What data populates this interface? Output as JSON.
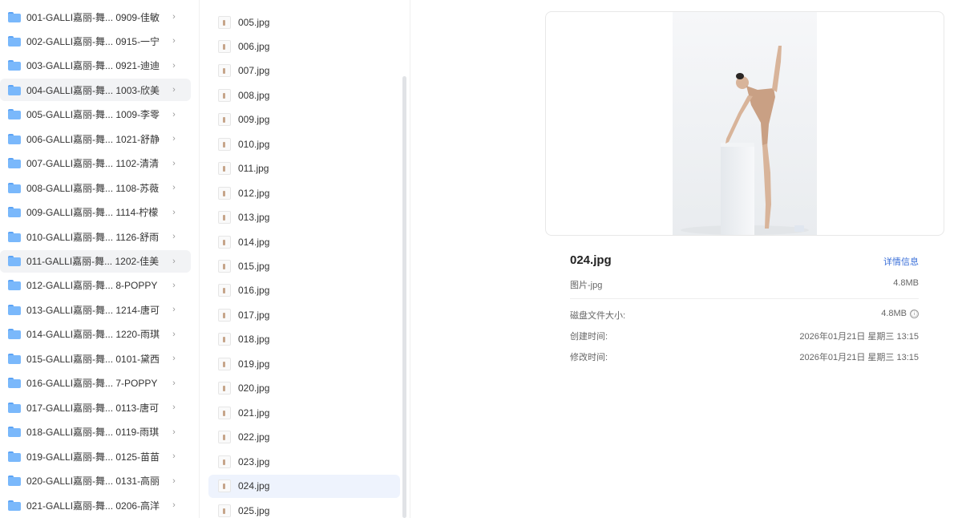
{
  "folders": [
    {
      "label": "001-GALLI嘉丽-舞... 0909-佳敏"
    },
    {
      "label": "002-GALLI嘉丽-舞... 0915-一宁"
    },
    {
      "label": "003-GALLI嘉丽-舞... 0921-迪迪"
    },
    {
      "label": "004-GALLI嘉丽-舞... 1003-欣美"
    },
    {
      "label": "005-GALLI嘉丽-舞... 1009-李零"
    },
    {
      "label": "006-GALLI嘉丽-舞... 1021-舒静"
    },
    {
      "label": "007-GALLI嘉丽-舞... 1102-清清"
    },
    {
      "label": "008-GALLI嘉丽-舞... 1108-苏薇"
    },
    {
      "label": "009-GALLI嘉丽-舞... 1114-柠檬"
    },
    {
      "label": "010-GALLI嘉丽-舞... 1126-舒雨"
    },
    {
      "label": "011-GALLI嘉丽-舞... 1202-佳美"
    },
    {
      "label": "012-GALLI嘉丽-舞... 8-POPPY"
    },
    {
      "label": "013-GALLI嘉丽-舞... 1214-唐可"
    },
    {
      "label": "014-GALLI嘉丽-舞... 1220-雨琪"
    },
    {
      "label": "015-GALLI嘉丽-舞... 0101-黛西"
    },
    {
      "label": "016-GALLI嘉丽-舞... 7-POPPY"
    },
    {
      "label": "017-GALLI嘉丽-舞... 0113-唐可"
    },
    {
      "label": "018-GALLI嘉丽-舞... 0119-雨琪"
    },
    {
      "label": "019-GALLI嘉丽-舞... 0125-苗苗"
    },
    {
      "label": "020-GALLI嘉丽-舞... 0131-高丽"
    },
    {
      "label": "021-GALLI嘉丽-舞... 0206-高洋"
    }
  ],
  "highlighted_folders": [
    3,
    10
  ],
  "files": [
    {
      "label": "005.jpg"
    },
    {
      "label": "006.jpg"
    },
    {
      "label": "007.jpg"
    },
    {
      "label": "008.jpg"
    },
    {
      "label": "009.jpg"
    },
    {
      "label": "010.jpg"
    },
    {
      "label": "011.jpg"
    },
    {
      "label": "012.jpg"
    },
    {
      "label": "013.jpg"
    },
    {
      "label": "014.jpg"
    },
    {
      "label": "015.jpg"
    },
    {
      "label": "016.jpg"
    },
    {
      "label": "017.jpg"
    },
    {
      "label": "018.jpg"
    },
    {
      "label": "019.jpg"
    },
    {
      "label": "020.jpg"
    },
    {
      "label": "021.jpg"
    },
    {
      "label": "022.jpg"
    },
    {
      "label": "023.jpg"
    },
    {
      "label": "024.jpg"
    },
    {
      "label": "025.jpg"
    }
  ],
  "selected_file": 19,
  "preview": {
    "name": "024.jpg",
    "detail_link": "详情信息",
    "type": "图片-jpg",
    "size": "4.8MB",
    "disk_size_label": "磁盘文件大小:",
    "disk_size": "4.8MB",
    "info_icon": "ⓘ",
    "created_label": "创建时间:",
    "created": "2026年01月21日 星期三 13:15",
    "modified_label": "修改时间:",
    "modified": "2026年01月21日 星期三 13:15"
  },
  "colors": {
    "folder": "#7ab8fb",
    "selected_row": "#eef3fd",
    "highlight_row": "#f2f3f5",
    "link": "#3a6fd8"
  }
}
